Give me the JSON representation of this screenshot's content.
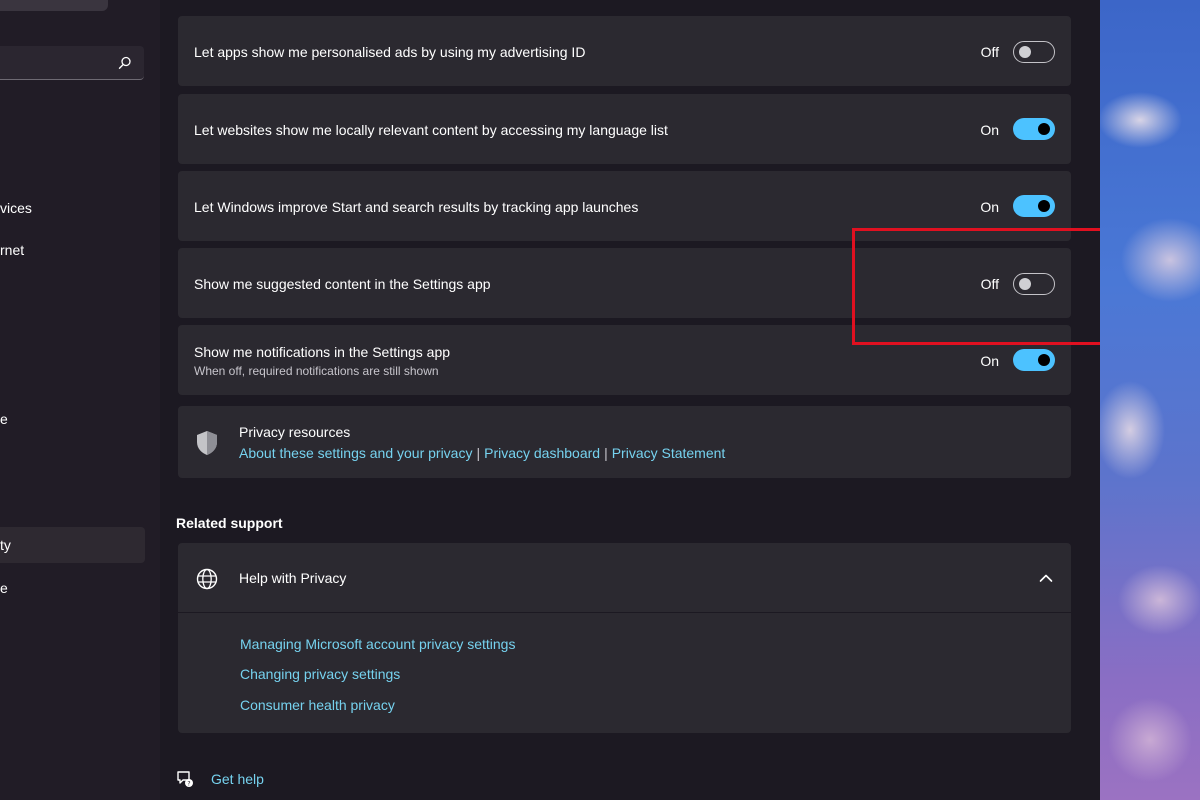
{
  "sidebar": {
    "nav_items": [
      "vices",
      "rnet",
      "e",
      "ty",
      "e"
    ]
  },
  "rows": [
    {
      "label": "Let apps show me personalised ads by using my advertising ID",
      "state": "Off"
    },
    {
      "label": "Let websites show me locally relevant content by accessing my language list",
      "state": "On"
    },
    {
      "label": "Let Windows improve Start and search results by tracking app launches",
      "state": "On"
    },
    {
      "label": "Show me suggested content in the Settings app",
      "state": "Off"
    },
    {
      "label": "Show me notifications in the Settings app",
      "sublabel": "When off, required notifications are still shown",
      "state": "On"
    }
  ],
  "privacy_resources": {
    "title": "Privacy resources",
    "links": [
      "About these settings and your privacy",
      "Privacy dashboard",
      "Privacy Statement"
    ],
    "separator": "|"
  },
  "related_support": {
    "title": "Related support",
    "help_title": "Help with Privacy",
    "links": [
      "Managing Microsoft account privacy settings",
      "Changing privacy settings",
      "Consumer health privacy"
    ]
  },
  "get_help": "Get help",
  "colors": {
    "accent": "#4cc2ff",
    "link": "#76d2ef",
    "highlight": "#e01020"
  },
  "icons": [
    "search-icon",
    "shield-icon",
    "globe-icon",
    "chevron-up-icon",
    "get-help-icon"
  ]
}
